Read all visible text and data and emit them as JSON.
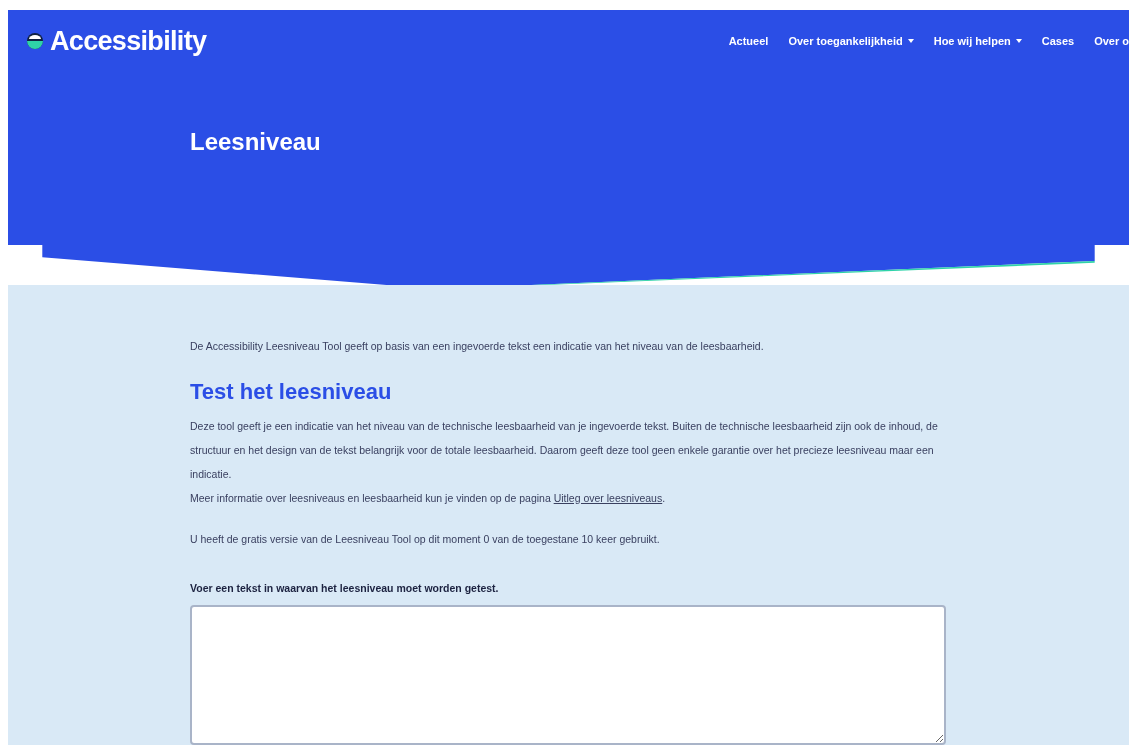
{
  "header": {
    "logo": "Accessibility",
    "nav": [
      {
        "label": "Actueel",
        "dropdown": false
      },
      {
        "label": "Over toegankelijkheid",
        "dropdown": true
      },
      {
        "label": "Hoe wij helpen",
        "dropdown": true
      },
      {
        "label": "Cases",
        "dropdown": false
      },
      {
        "label": "Over o",
        "dropdown": false
      }
    ],
    "title": "Leesniveau"
  },
  "intro": "De Accessibility Leesniveau Tool geeft op basis van een ingevoerde tekst een indicatie van het niveau van de leesbaarheid.",
  "heading": "Test het leesniveau",
  "body": "Deze tool geeft je een indicatie van het niveau van de technische leesbaarheid van je ingevoerde tekst. Buiten de technische leesbaarheid zijn ook de inhoud, de structuur en het design van de tekst belangrijk voor de totale leesbaarheid. Daarom geeft deze tool geen enkele garantie over het precieze leesniveau maar een indicatie.",
  "more_info": "Meer informatie over leesniveaus en leesbaarheid kun je vinden op de pagina",
  "more_info_link": "Uitleg over leesniveaus",
  "more_info_end": ".",
  "usage": "U heeft de gratis versie van de Leesniveau Tool op dit moment 0 van de toegestane 10 keer gebruikt.",
  "field_label": "Voer een tekst in waarvan het leesniveau moet worden getest."
}
